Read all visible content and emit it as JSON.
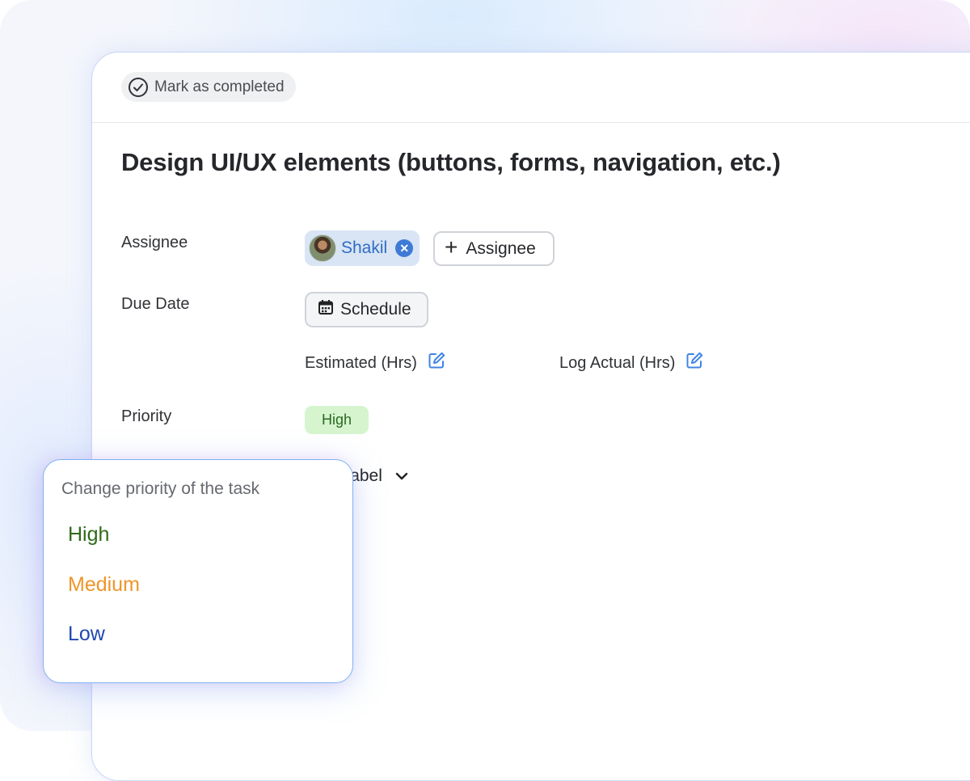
{
  "toolbar": {
    "mark_completed_label": "Mark as completed"
  },
  "task": {
    "title": "Design UI/UX elements (buttons, forms, navigation, etc.)"
  },
  "fields": {
    "assignee_label": "Assignee",
    "due_date_label": "Due Date",
    "priority_label": "Priority"
  },
  "assignee": {
    "name": "Shakil",
    "add_label": "Assignee"
  },
  "due_date": {
    "schedule_label": "Schedule"
  },
  "hours": {
    "estimated_label": "Estimated (Hrs)",
    "actual_label": "Log Actual (Hrs)"
  },
  "priority": {
    "current": "High"
  },
  "label_dropdown": {
    "visible_text": "e Label"
  },
  "popover": {
    "title": "Change priority of the task",
    "options": [
      {
        "label": "High",
        "color": "#2f6a18"
      },
      {
        "label": "Medium",
        "color": "#ef9528"
      },
      {
        "label": "Low",
        "color": "#1f49b0"
      }
    ]
  },
  "colors": {
    "accent_blue": "#3f7bd6",
    "priority_high_bg": "#d6f5cf",
    "panel_border": "#c9dcf6"
  },
  "icons": [
    "check-circle-icon",
    "close-icon",
    "plus-icon",
    "calendar-icon",
    "edit-icon",
    "chevron-down-icon"
  ]
}
